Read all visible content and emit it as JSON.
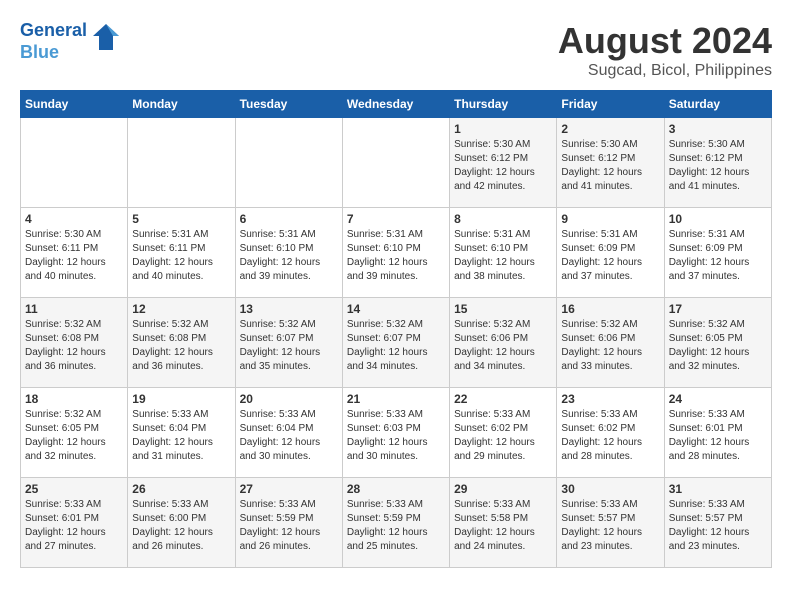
{
  "header": {
    "logo_line1": "General",
    "logo_line2": "Blue",
    "main_title": "August 2024",
    "subtitle": "Sugcad, Bicol, Philippines"
  },
  "days_of_week": [
    "Sunday",
    "Monday",
    "Tuesday",
    "Wednesday",
    "Thursday",
    "Friday",
    "Saturday"
  ],
  "weeks": [
    [
      {
        "day": "",
        "info": ""
      },
      {
        "day": "",
        "info": ""
      },
      {
        "day": "",
        "info": ""
      },
      {
        "day": "",
        "info": ""
      },
      {
        "day": "1",
        "info": "Sunrise: 5:30 AM\nSunset: 6:12 PM\nDaylight: 12 hours\nand 42 minutes."
      },
      {
        "day": "2",
        "info": "Sunrise: 5:30 AM\nSunset: 6:12 PM\nDaylight: 12 hours\nand 41 minutes."
      },
      {
        "day": "3",
        "info": "Sunrise: 5:30 AM\nSunset: 6:12 PM\nDaylight: 12 hours\nand 41 minutes."
      }
    ],
    [
      {
        "day": "4",
        "info": "Sunrise: 5:30 AM\nSunset: 6:11 PM\nDaylight: 12 hours\nand 40 minutes."
      },
      {
        "day": "5",
        "info": "Sunrise: 5:31 AM\nSunset: 6:11 PM\nDaylight: 12 hours\nand 40 minutes."
      },
      {
        "day": "6",
        "info": "Sunrise: 5:31 AM\nSunset: 6:10 PM\nDaylight: 12 hours\nand 39 minutes."
      },
      {
        "day": "7",
        "info": "Sunrise: 5:31 AM\nSunset: 6:10 PM\nDaylight: 12 hours\nand 39 minutes."
      },
      {
        "day": "8",
        "info": "Sunrise: 5:31 AM\nSunset: 6:10 PM\nDaylight: 12 hours\nand 38 minutes."
      },
      {
        "day": "9",
        "info": "Sunrise: 5:31 AM\nSunset: 6:09 PM\nDaylight: 12 hours\nand 37 minutes."
      },
      {
        "day": "10",
        "info": "Sunrise: 5:31 AM\nSunset: 6:09 PM\nDaylight: 12 hours\nand 37 minutes."
      }
    ],
    [
      {
        "day": "11",
        "info": "Sunrise: 5:32 AM\nSunset: 6:08 PM\nDaylight: 12 hours\nand 36 minutes."
      },
      {
        "day": "12",
        "info": "Sunrise: 5:32 AM\nSunset: 6:08 PM\nDaylight: 12 hours\nand 36 minutes."
      },
      {
        "day": "13",
        "info": "Sunrise: 5:32 AM\nSunset: 6:07 PM\nDaylight: 12 hours\nand 35 minutes."
      },
      {
        "day": "14",
        "info": "Sunrise: 5:32 AM\nSunset: 6:07 PM\nDaylight: 12 hours\nand 34 minutes."
      },
      {
        "day": "15",
        "info": "Sunrise: 5:32 AM\nSunset: 6:06 PM\nDaylight: 12 hours\nand 34 minutes."
      },
      {
        "day": "16",
        "info": "Sunrise: 5:32 AM\nSunset: 6:06 PM\nDaylight: 12 hours\nand 33 minutes."
      },
      {
        "day": "17",
        "info": "Sunrise: 5:32 AM\nSunset: 6:05 PM\nDaylight: 12 hours\nand 32 minutes."
      }
    ],
    [
      {
        "day": "18",
        "info": "Sunrise: 5:32 AM\nSunset: 6:05 PM\nDaylight: 12 hours\nand 32 minutes."
      },
      {
        "day": "19",
        "info": "Sunrise: 5:33 AM\nSunset: 6:04 PM\nDaylight: 12 hours\nand 31 minutes."
      },
      {
        "day": "20",
        "info": "Sunrise: 5:33 AM\nSunset: 6:04 PM\nDaylight: 12 hours\nand 30 minutes."
      },
      {
        "day": "21",
        "info": "Sunrise: 5:33 AM\nSunset: 6:03 PM\nDaylight: 12 hours\nand 30 minutes."
      },
      {
        "day": "22",
        "info": "Sunrise: 5:33 AM\nSunset: 6:02 PM\nDaylight: 12 hours\nand 29 minutes."
      },
      {
        "day": "23",
        "info": "Sunrise: 5:33 AM\nSunset: 6:02 PM\nDaylight: 12 hours\nand 28 minutes."
      },
      {
        "day": "24",
        "info": "Sunrise: 5:33 AM\nSunset: 6:01 PM\nDaylight: 12 hours\nand 28 minutes."
      }
    ],
    [
      {
        "day": "25",
        "info": "Sunrise: 5:33 AM\nSunset: 6:01 PM\nDaylight: 12 hours\nand 27 minutes."
      },
      {
        "day": "26",
        "info": "Sunrise: 5:33 AM\nSunset: 6:00 PM\nDaylight: 12 hours\nand 26 minutes."
      },
      {
        "day": "27",
        "info": "Sunrise: 5:33 AM\nSunset: 5:59 PM\nDaylight: 12 hours\nand 26 minutes."
      },
      {
        "day": "28",
        "info": "Sunrise: 5:33 AM\nSunset: 5:59 PM\nDaylight: 12 hours\nand 25 minutes."
      },
      {
        "day": "29",
        "info": "Sunrise: 5:33 AM\nSunset: 5:58 PM\nDaylight: 12 hours\nand 24 minutes."
      },
      {
        "day": "30",
        "info": "Sunrise: 5:33 AM\nSunset: 5:57 PM\nDaylight: 12 hours\nand 23 minutes."
      },
      {
        "day": "31",
        "info": "Sunrise: 5:33 AM\nSunset: 5:57 PM\nDaylight: 12 hours\nand 23 minutes."
      }
    ]
  ]
}
